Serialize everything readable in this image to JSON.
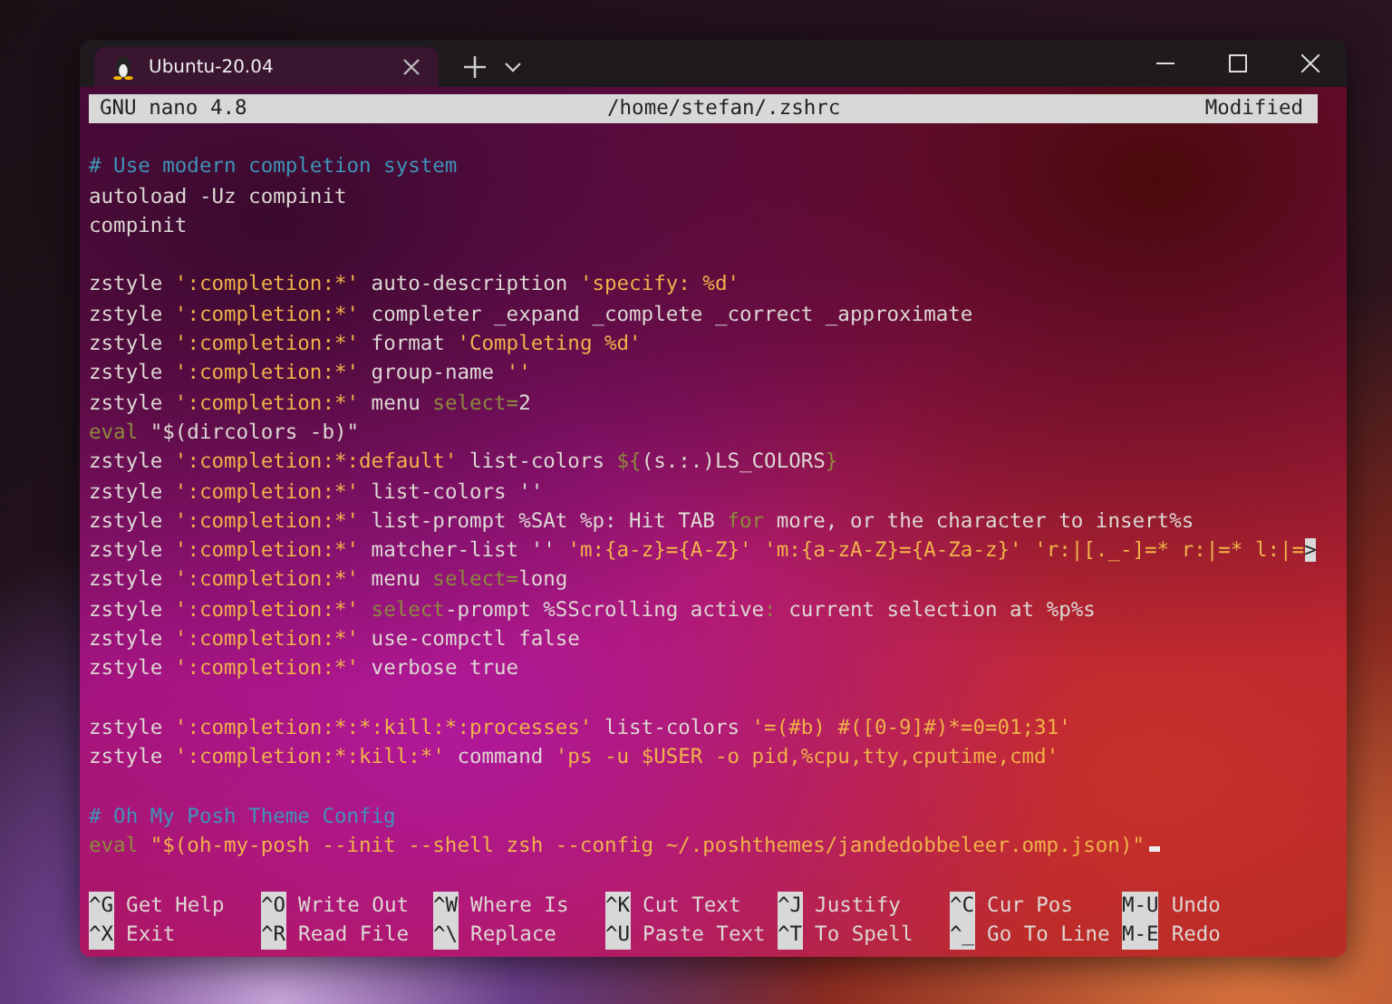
{
  "window": {
    "tab": {
      "title": "Ubuntu-20.04",
      "selected": true
    }
  },
  "nano": {
    "header": {
      "app": "GNU nano 4.8",
      "file": "/home/stefan/.zshrc",
      "status": "Modified"
    },
    "lines": [
      {
        "kind": "blank"
      },
      {
        "kind": "code",
        "segments": [
          {
            "kind": "comment",
            "text": "# Use modern completion system"
          }
        ]
      },
      {
        "kind": "code",
        "segments": [
          {
            "kind": "plain",
            "text": "autoload -Uz compinit"
          }
        ]
      },
      {
        "kind": "code",
        "segments": [
          {
            "kind": "plain",
            "text": "compinit"
          }
        ]
      },
      {
        "kind": "blank"
      },
      {
        "kind": "code",
        "segments": [
          {
            "kind": "plain",
            "text": "zstyle "
          },
          {
            "kind": "string",
            "text": "':completion:*'"
          },
          {
            "kind": "plain",
            "text": " auto-description "
          },
          {
            "kind": "string",
            "text": "'specify: %d'"
          }
        ]
      },
      {
        "kind": "code",
        "segments": [
          {
            "kind": "plain",
            "text": "zstyle "
          },
          {
            "kind": "string",
            "text": "':completion:*'"
          },
          {
            "kind": "plain",
            "text": " completer _expand _complete _correct _approximate"
          }
        ]
      },
      {
        "kind": "code",
        "segments": [
          {
            "kind": "plain",
            "text": "zstyle "
          },
          {
            "kind": "string",
            "text": "':completion:*'"
          },
          {
            "kind": "plain",
            "text": " format "
          },
          {
            "kind": "string",
            "text": "'Completing %d'"
          }
        ]
      },
      {
        "kind": "code",
        "segments": [
          {
            "kind": "plain",
            "text": "zstyle "
          },
          {
            "kind": "string",
            "text": "':completion:*'"
          },
          {
            "kind": "plain",
            "text": " group-name "
          },
          {
            "kind": "string",
            "text": "''"
          }
        ]
      },
      {
        "kind": "code",
        "segments": [
          {
            "kind": "plain",
            "text": "zstyle "
          },
          {
            "kind": "string",
            "text": "':completion:*'"
          },
          {
            "kind": "plain",
            "text": " menu "
          },
          {
            "kind": "keyword",
            "text": "select="
          },
          {
            "kind": "plain",
            "text": "2"
          }
        ]
      },
      {
        "kind": "code",
        "segments": [
          {
            "kind": "keyword",
            "text": "eval"
          },
          {
            "kind": "plain",
            "text": " \"$(dircolors -b)\""
          }
        ]
      },
      {
        "kind": "code",
        "segments": [
          {
            "kind": "plain",
            "text": "zstyle "
          },
          {
            "kind": "string",
            "text": "':completion:*:default'"
          },
          {
            "kind": "plain",
            "text": " list-colors "
          },
          {
            "kind": "keyword",
            "text": "${"
          },
          {
            "kind": "plain",
            "text": "(s.:.)LS_COLORS"
          },
          {
            "kind": "keyword",
            "text": "}"
          }
        ]
      },
      {
        "kind": "code",
        "segments": [
          {
            "kind": "plain",
            "text": "zstyle "
          },
          {
            "kind": "string",
            "text": "':completion:*'"
          },
          {
            "kind": "plain",
            "text": " list-colors ''"
          }
        ]
      },
      {
        "kind": "code",
        "segments": [
          {
            "kind": "plain",
            "text": "zstyle "
          },
          {
            "kind": "string",
            "text": "':completion:*'"
          },
          {
            "kind": "plain",
            "text": " list-prompt %SAt %p: Hit TAB "
          },
          {
            "kind": "keyword",
            "text": "for"
          },
          {
            "kind": "plain",
            "text": " more, or the character to insert%s"
          }
        ]
      },
      {
        "kind": "code",
        "segments": [
          {
            "kind": "plain",
            "text": "zstyle "
          },
          {
            "kind": "string",
            "text": "':completion:*'"
          },
          {
            "kind": "plain",
            "text": " matcher-list '' "
          },
          {
            "kind": "string",
            "text": "'m:{a-z}={A-Z}' 'm:{a-zA-Z}={A-Za-z}' 'r:|[._-]=* r:|=* l:|="
          },
          {
            "kind": "marker",
            "text": ">"
          }
        ]
      },
      {
        "kind": "code",
        "segments": [
          {
            "kind": "plain",
            "text": "zstyle "
          },
          {
            "kind": "string",
            "text": "':completion:*'"
          },
          {
            "kind": "plain",
            "text": " menu "
          },
          {
            "kind": "keyword",
            "text": "select="
          },
          {
            "kind": "plain",
            "text": "long"
          }
        ]
      },
      {
        "kind": "code",
        "segments": [
          {
            "kind": "plain",
            "text": "zstyle "
          },
          {
            "kind": "string",
            "text": "':completion:*' "
          },
          {
            "kind": "keyword",
            "text": "select"
          },
          {
            "kind": "plain",
            "text": "-prompt %SScrolling active"
          },
          {
            "kind": "keyword",
            "text": ":"
          },
          {
            "kind": "plain",
            "text": " current selection at %p%s"
          }
        ]
      },
      {
        "kind": "code",
        "segments": [
          {
            "kind": "plain",
            "text": "zstyle "
          },
          {
            "kind": "string",
            "text": "':completion:*'"
          },
          {
            "kind": "plain",
            "text": " use-compctl false"
          }
        ]
      },
      {
        "kind": "code",
        "segments": [
          {
            "kind": "plain",
            "text": "zstyle "
          },
          {
            "kind": "string",
            "text": "':completion:*'"
          },
          {
            "kind": "plain",
            "text": " verbose true"
          }
        ]
      },
      {
        "kind": "blank"
      },
      {
        "kind": "code",
        "segments": [
          {
            "kind": "plain",
            "text": "zstyle "
          },
          {
            "kind": "string",
            "text": "':completion:*:*:kill:*:processes'"
          },
          {
            "kind": "plain",
            "text": " list-colors "
          },
          {
            "kind": "string",
            "text": "'=(#b) #([0-9]#)*=0=01;31'"
          }
        ]
      },
      {
        "kind": "code",
        "segments": [
          {
            "kind": "plain",
            "text": "zstyle "
          },
          {
            "kind": "string",
            "text": "':completion:*:kill:*'"
          },
          {
            "kind": "plain",
            "text": " command "
          },
          {
            "kind": "string",
            "text": "'ps -u $USER -o pid,%cpu,tty,cputime,cmd'"
          }
        ]
      },
      {
        "kind": "blank"
      },
      {
        "kind": "code",
        "segments": [
          {
            "kind": "comment",
            "text": "# Oh My Posh Theme Config"
          }
        ]
      },
      {
        "kind": "code",
        "cursor": true,
        "segments": [
          {
            "kind": "keyword",
            "text": "eval"
          },
          {
            "kind": "string",
            "text": " \"$(oh-my-posh --init --shell zsh --config ~/.poshthemes/jandedobbeleer.omp.json)\""
          }
        ]
      },
      {
        "kind": "blank"
      }
    ],
    "shortcuts": [
      [
        {
          "key": "^G",
          "label": "Get Help"
        },
        {
          "key": "^O",
          "label": "Write Out"
        },
        {
          "key": "^W",
          "label": "Where Is"
        },
        {
          "key": "^K",
          "label": "Cut Text"
        },
        {
          "key": "^J",
          "label": "Justify"
        },
        {
          "key": "^C",
          "label": "Cur Pos"
        },
        {
          "key": "M-U",
          "label": "Undo"
        }
      ],
      [
        {
          "key": "^X",
          "label": "Exit"
        },
        {
          "key": "^R",
          "label": "Read File"
        },
        {
          "key": "^\\",
          "label": "Replace"
        },
        {
          "key": "^U",
          "label": "Paste Text"
        },
        {
          "key": "^T",
          "label": "To Spell"
        },
        {
          "key": "^_",
          "label": "Go To Line"
        },
        {
          "key": "M-E",
          "label": "Redo"
        }
      ]
    ]
  }
}
